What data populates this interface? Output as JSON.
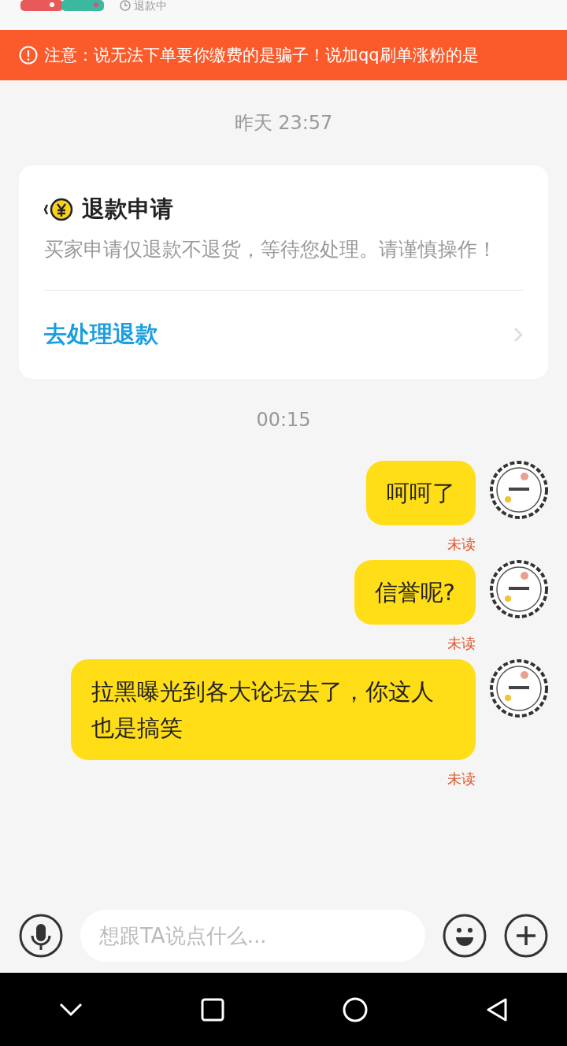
{
  "header": {
    "status": "退款中"
  },
  "notice": {
    "text": "注意：说无法下单要你缴费的是骗子！说加qq刷单涨粉的是"
  },
  "chat": [
    {
      "kind": "time",
      "text": "昨天 23:57"
    },
    {
      "kind": "card",
      "title": "退款申请",
      "body": "买家申请仅退款不退货，等待您处理。请谨慎操作！",
      "action": "去处理退款"
    },
    {
      "kind": "time",
      "text": "00:15"
    },
    {
      "kind": "message",
      "text": "呵呵了",
      "status": "未读"
    },
    {
      "kind": "message",
      "text": "信誉呢?",
      "status": "未读"
    },
    {
      "kind": "message",
      "text": "拉黑曝光到各大论坛去了，你这人也是搞笑",
      "status": "未读"
    }
  ],
  "input": {
    "placeholder": "想跟TA说点什么..."
  }
}
